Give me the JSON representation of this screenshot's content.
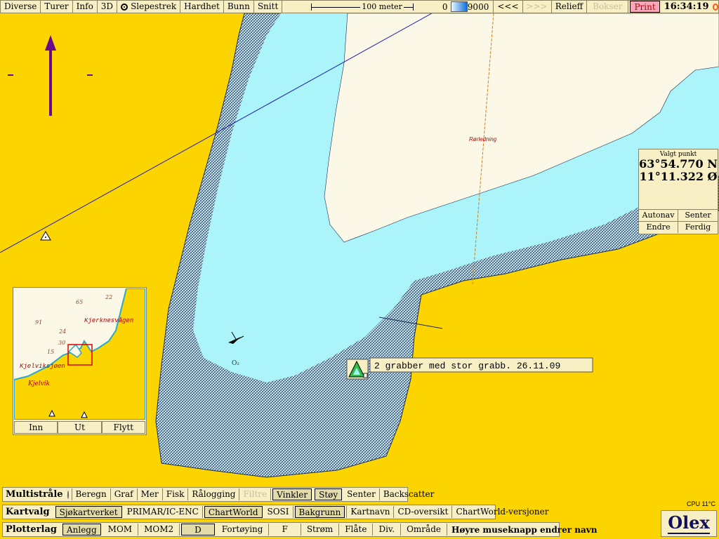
{
  "top_toolbar": {
    "items": [
      "Diverse",
      "Turer",
      "Info",
      "3D"
    ],
    "slepestrek": "Slepestrek",
    "items2": [
      "Hardhet",
      "Bunn",
      "Snitt"
    ],
    "scale_label": "100 meter",
    "depth_min": "0",
    "depth_max": "9000",
    "prev_label": "<<<",
    "next_label": ">>>",
    "relieff": "Relieff",
    "bokser": "Bokser",
    "print": "Print",
    "time": "16:34:19"
  },
  "map": {
    "annotation_label": "2 grabber med stor grabb. 26.11.09",
    "pipeline_label": "Rørledning",
    "o2_label": "O₂"
  },
  "position_panel": {
    "title": "Valgt punkt",
    "lat": "63°54.770 N",
    "lon": "11°11.322 Ø",
    "buttons": [
      "Autonav",
      "Senter",
      "Endre",
      "Ferdig"
    ]
  },
  "overview": {
    "place_labels": [
      "Kjerknesvågen",
      "Kjelviksjøen",
      "Kjelvik"
    ],
    "depth_labels": [
      "65",
      "22",
      "91",
      "24",
      "30",
      "15"
    ],
    "buttons": [
      "Inn",
      "Ut",
      "Flytt"
    ]
  },
  "multistrale": {
    "label": "Multistråle",
    "items": [
      "Beregn",
      "Graf",
      "Mer",
      "Fisk",
      "Rålogging",
      "Filtre",
      "Vinkler",
      "Støy",
      "Senter",
      "Backscatter"
    ]
  },
  "kartvalg": {
    "label": "Kartvalg",
    "items": [
      "Sjøkartverket",
      "PRIMAR/IC-ENC",
      "ChartWorld",
      "SOSI",
      "Bakgrunn",
      "Kartnavn",
      "CD-oversikt",
      "ChartWorld-versjoner"
    ]
  },
  "plotterlag": {
    "label": "Plotterlag",
    "items": [
      "Anlegg",
      "MOM",
      "MOM2",
      "D",
      "Fortøying",
      "F",
      "Strøm",
      "Flåte",
      "Div.",
      "Område"
    ],
    "hint": "Høyre museknapp endrer navn"
  },
  "status": {
    "cpu": "CPU 11°C",
    "logo": "Olex"
  },
  "colors": {
    "land": "#fcd400",
    "shallow": "#b8e4f0",
    "water": "#aaf4fa",
    "deep": "#fcf8e8",
    "panel": "#f8f0c4"
  }
}
